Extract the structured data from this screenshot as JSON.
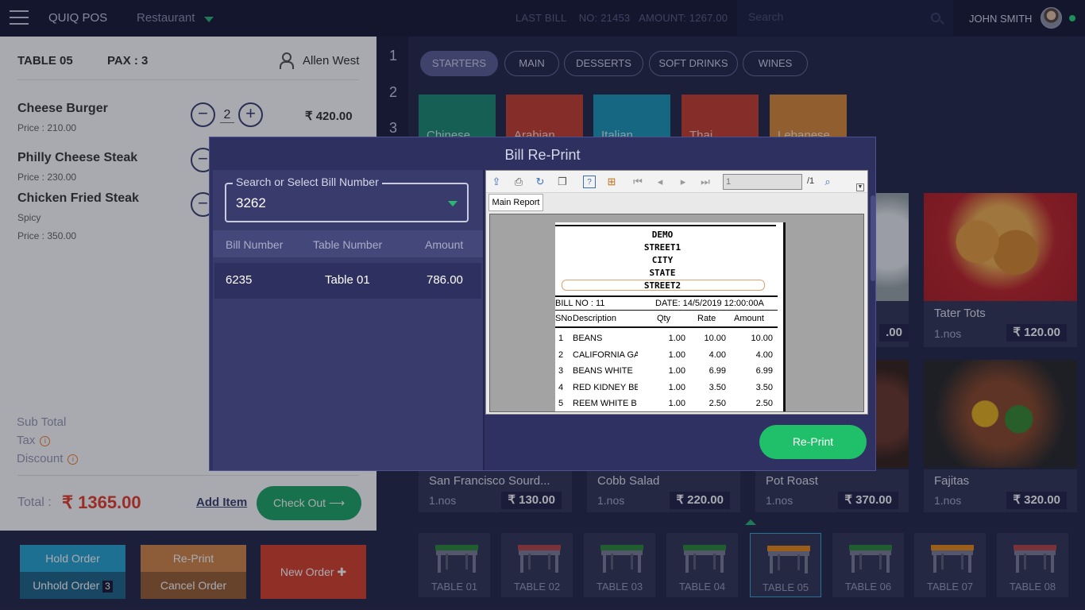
{
  "header": {
    "brand": "QUIQ POS",
    "outlet": "Restaurant",
    "last_bill_label": "LAST BILL",
    "last_bill_no": "NO: 21453",
    "last_bill_amount": "AMOUNT: 1267.00",
    "search_placeholder": "Search",
    "user": "JOHN SMITH"
  },
  "order": {
    "table": "TABLE 05",
    "pax": "PAX : 3",
    "waiter": "Allen West",
    "items": [
      {
        "name": "Cheese Burger",
        "price": "Price  : 210.00",
        "qty": "2",
        "amount": "₹ 420.00"
      },
      {
        "name": "Philly Cheese Steak",
        "price": "Price  : 230.00"
      },
      {
        "name": "Chicken Fried Steak",
        "note": "Spicy",
        "price": "Price  : 350.00"
      }
    ],
    "subtotal_label": "Sub Total",
    "tax_label": "Tax",
    "discount_label": "Discount",
    "total_label": "Total :",
    "total_value": "₹ 1365.00",
    "add_item": "Add Item",
    "checkout": "Check Out ⟶"
  },
  "actions": {
    "hold": "Hold Order",
    "unhold": "Unhold Order",
    "unhold_count": "3",
    "reprint": "Re-Print",
    "cancel": "Cancel Order",
    "new_order": "New Order ✚"
  },
  "rail": [
    "1",
    "2",
    "3"
  ],
  "categories": [
    "STARTERS",
    "MAIN",
    "DESSERTS",
    "SOFT DRINKS",
    "WINES"
  ],
  "cuisines": [
    "Chinese",
    "Arabian",
    "Italian",
    "Thai",
    "Lebanese"
  ],
  "foods": [
    {
      "name": "",
      "unit": "",
      "price": ".00"
    },
    {
      "name": "Tater Tots",
      "unit": "1.nos",
      "price": "₹ 120.00"
    },
    {
      "name": "San Francisco Sourd...",
      "unit": "1.nos",
      "price": "₹ 130.00"
    },
    {
      "name": "Cobb Salad",
      "unit": "1.nos",
      "price": "₹ 220.00"
    },
    {
      "name": "Pot Roast",
      "unit": "1.nos",
      "price": "₹ 370.00"
    },
    {
      "name": "Fajitas",
      "unit": "1.nos",
      "price": "₹ 320.00"
    }
  ],
  "tables": [
    "TABLE 01",
    "TABLE 02",
    "TABLE 03",
    "TABLE 04",
    "TABLE 05",
    "TABLE 06",
    "TABLE 07",
    "TABLE 08"
  ],
  "table_colors": [
    "#2e8b3a",
    "#b5454a",
    "#2e8b3a",
    "#2e8b3a",
    "#e88a17",
    "#2e8b3a",
    "#e88a17",
    "#b5454a"
  ],
  "modal": {
    "title": "Bill Re-Print",
    "search_label": "Search or Select Bill Number",
    "search_value": "3262",
    "columns": [
      "Bill Number",
      "Table Number",
      "Amount"
    ],
    "row": {
      "bill": "6235",
      "table": "Table 01",
      "amount": "786.00"
    },
    "reprint_button": "Re-Print"
  },
  "viewer": {
    "page": "1",
    "page_total": "/1",
    "tab": "Main Report",
    "header_lines": [
      "DEMO",
      "STREET1",
      "CITY",
      "STATE",
      "STREET2"
    ],
    "bill_no": "BILL NO  :     11",
    "date": "DATE: 14/5/2019 12:00:00A",
    "columns": [
      "SNo",
      "Description",
      "Qty",
      "Rate",
      "Amount"
    ],
    "rows": [
      [
        "1",
        "BEANS",
        "1.00",
        "10.00",
        "10.00"
      ],
      [
        "2",
        "CALIFORNIA GA",
        "1.00",
        "4.00",
        "4.00"
      ],
      [
        "3",
        "BEANS WHITE",
        "1.00",
        "6.99",
        "6.99"
      ],
      [
        "4",
        "RED KIDNEY BE",
        "1.00",
        "3.50",
        "3.50"
      ],
      [
        "5",
        "REEM WHITE B",
        "1.00",
        "2.50",
        "2.50"
      ]
    ]
  }
}
